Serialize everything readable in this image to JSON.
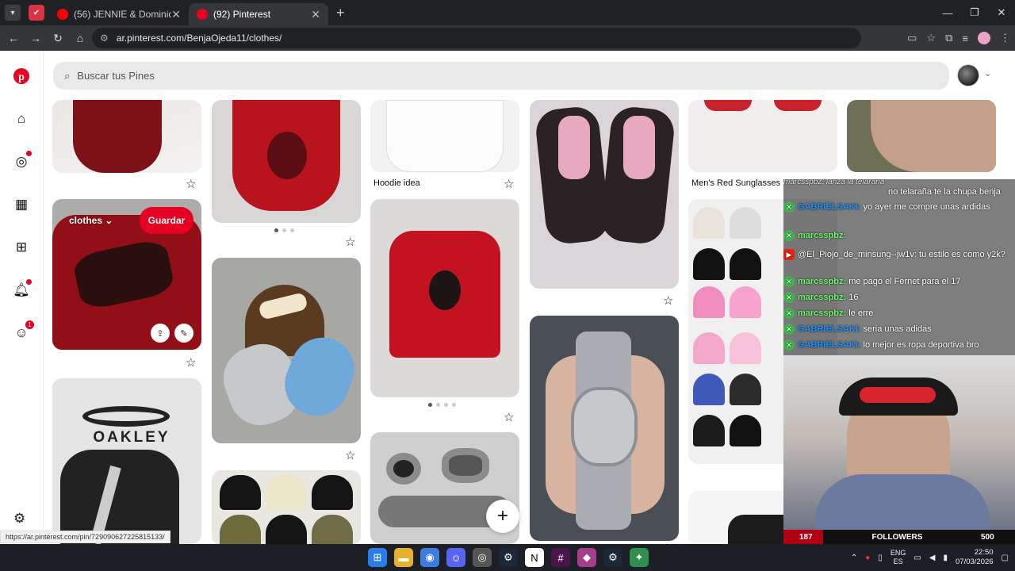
{
  "browser": {
    "tabs": [
      {
        "title": "(56) JENNIE & Dominic Fike - Li",
        "favicon_color": "#ff0000",
        "active": false
      },
      {
        "title": "(92) Pinterest",
        "favicon_color": "#e60023",
        "active": true
      }
    ],
    "url": "ar.pinterest.com/BenjaOjeda11/clothes/",
    "status_url": "https://ar.pinterest.com/pin/729090627225815133/"
  },
  "pinterest": {
    "search_placeholder": "Buscar tus Pines",
    "board_selector": "clothes",
    "save_label": "Guardar",
    "notifications_badge": "1",
    "pins": [
      {
        "title": "Hoodie idea"
      },
      {
        "title": "Men's Red Sunglasses"
      }
    ]
  },
  "stream": {
    "chat": [
      {
        "user": "marcsspbz:",
        "text": "lanza la telaraña",
        "reply": "no telaraña te la chupa benja",
        "style": "reply"
      },
      {
        "user": "GABRIELSAKI:",
        "text": "yo ayer me compre unas ardidas",
        "style": "blue"
      },
      {
        "user": "marcsspbz:",
        "text": "",
        "style": "green"
      },
      {
        "user": "@El_Piojo_de_minsung--jw1v:",
        "text": "tu estilo es como y2k?",
        "style": "white"
      },
      {
        "user": "marcsspbz:",
        "text": "me pago el Fernet para el 17",
        "style": "green"
      },
      {
        "user": "marcsspbz:",
        "text": "16",
        "style": "green"
      },
      {
        "user": "marcsspbz:",
        "text": "le erre",
        "style": "green"
      },
      {
        "user": "GABRIELSAKI:",
        "text": "seria unas adidas",
        "style": "blue"
      },
      {
        "user": "GABRIELSAKI:",
        "text": "lo mejor es ropa deportiva bro",
        "style": "blue"
      }
    ],
    "followers_label": "FOLLOWERS",
    "followers_current": "187",
    "followers_goal": "500"
  },
  "taskbar": {
    "lang_top": "ENG",
    "lang_bottom": "ES",
    "time": "22:50",
    "date": "07/03/2026"
  },
  "colors": {
    "pinterest_red": "#e60023",
    "chrome_dark": "#202124",
    "taskbar": "#1c1f26"
  }
}
